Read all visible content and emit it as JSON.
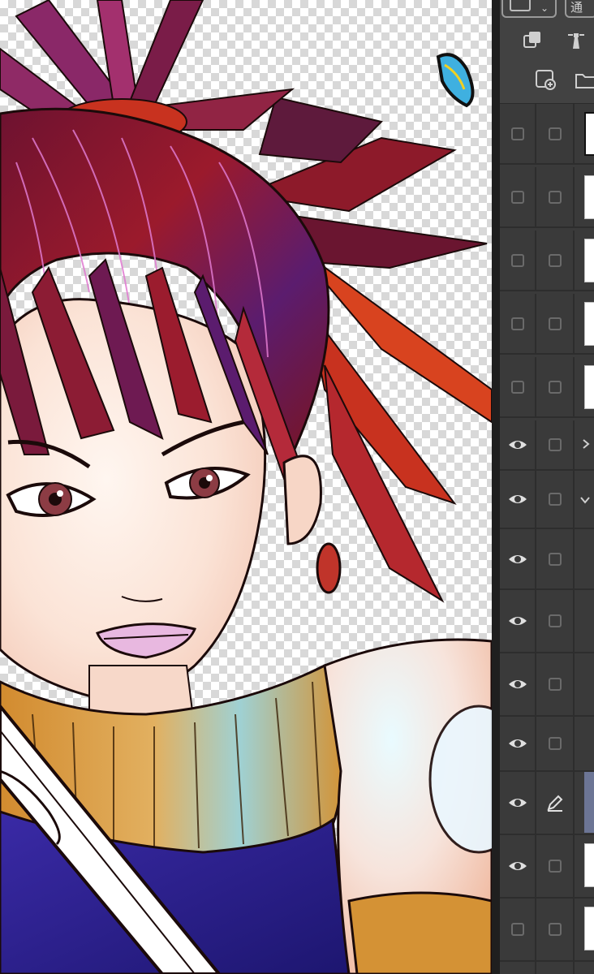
{
  "toolbar": {
    "mode_chip": "通",
    "blend_chevron": "⌄"
  },
  "layers": [
    {
      "id": "layer-1",
      "visible": false,
      "locked": false,
      "thumb": "dark"
    },
    {
      "id": "layer-2",
      "visible": false,
      "locked": false,
      "thumb": "light"
    },
    {
      "id": "layer-3",
      "visible": false,
      "locked": false,
      "thumb": "light"
    },
    {
      "id": "layer-4",
      "visible": false,
      "locked": false,
      "thumb": "light"
    },
    {
      "id": "layer-5",
      "visible": false,
      "locked": false,
      "thumb": "light"
    },
    {
      "id": "folder-1",
      "visible": true,
      "locked": false,
      "thumb": "folder-collapsed"
    },
    {
      "id": "folder-2",
      "visible": true,
      "locked": false,
      "thumb": "folder-expanded"
    },
    {
      "id": "layer-8",
      "visible": true,
      "locked": false,
      "thumb": "none"
    },
    {
      "id": "layer-9",
      "visible": true,
      "locked": false,
      "thumb": "none"
    },
    {
      "id": "layer-10",
      "visible": true,
      "locked": false,
      "thumb": "none"
    },
    {
      "id": "layer-11",
      "visible": true,
      "locked": false,
      "thumb": "none"
    },
    {
      "id": "layer-12",
      "visible": true,
      "locked": false,
      "thumb": "active",
      "editing": true
    },
    {
      "id": "layer-13",
      "visible": true,
      "locked": false,
      "thumb": "light"
    },
    {
      "id": "layer-14",
      "visible": false,
      "locked": false,
      "thumb": "light"
    }
  ],
  "colors": {
    "panel_bg": "#3a3a3a",
    "toolbar_bg": "#424242",
    "divider": "#1f1f1f",
    "active_layer": "#6c7595",
    "hair_dark": "#7a1020",
    "hair_magenta": "#b02e7a",
    "hair_orange": "#d8431f",
    "skin": "#fbe6dc",
    "sweater": "#d69a3a",
    "shirt": "#2a1f8c"
  }
}
